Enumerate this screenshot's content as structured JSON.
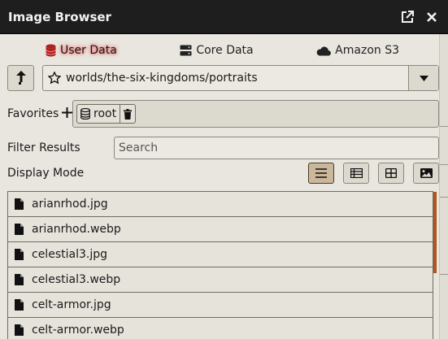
{
  "window": {
    "title": "Image Browser"
  },
  "tabs": [
    {
      "label": "User Data",
      "icon": "database-icon",
      "active": true
    },
    {
      "label": "Core Data",
      "icon": "server-icon",
      "active": false
    },
    {
      "label": "Amazon S3",
      "icon": "cloud-icon",
      "active": false
    }
  ],
  "path": {
    "value": "worlds/the-six-kingdoms/portraits"
  },
  "favorites": {
    "label": "Favorites",
    "chip_label": "root"
  },
  "filter": {
    "label": "Filter Results",
    "placeholder": "Search"
  },
  "display_mode": {
    "label": "Display Mode",
    "modes": [
      "list",
      "table",
      "tiles",
      "images"
    ],
    "active": "list"
  },
  "files": [
    {
      "name": "arianrhod.jpg"
    },
    {
      "name": "arianrhod.webp"
    },
    {
      "name": "celestial3.jpg"
    },
    {
      "name": "celestial3.webp"
    },
    {
      "name": "celt-armor.jpg"
    },
    {
      "name": "celt-armor.webp"
    }
  ],
  "colors": {
    "accent_active": "#e96060",
    "scrollbar": "#b3541e",
    "titlebar": "#1e1e1e"
  }
}
